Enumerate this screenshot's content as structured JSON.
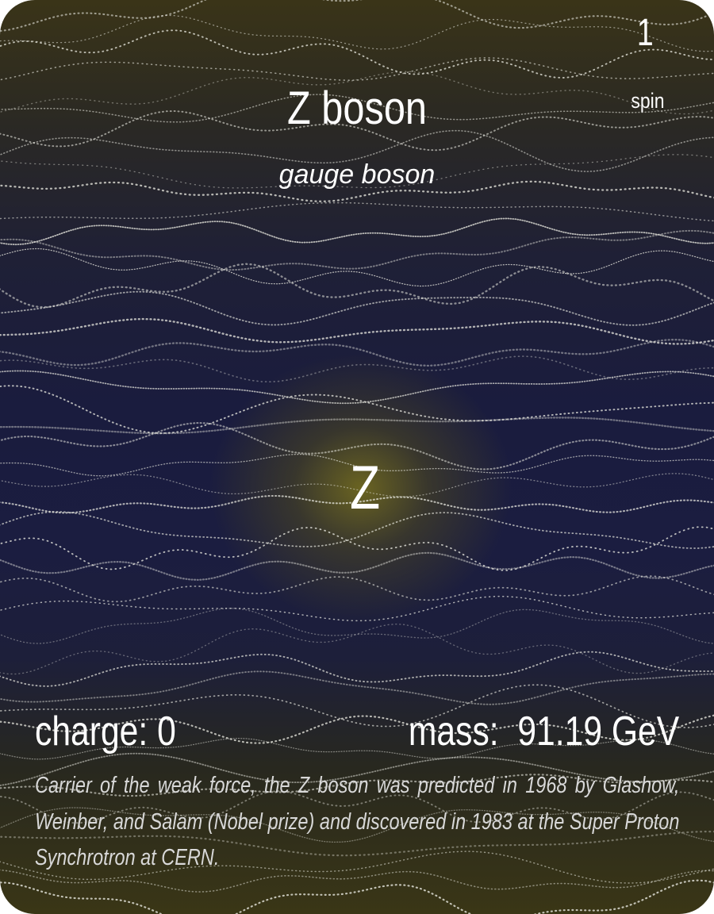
{
  "card": {
    "spin_value": "1",
    "spin_label": "spin",
    "name": "Z boson",
    "category": "gauge boson",
    "symbol": "Z",
    "charge_text": "charge: 0",
    "mass_text": "mass:  91.19 GeV",
    "description": "Carrier of the weak force, the Z boson was predicted in 1968 by Glashow, Weinber, and Salam (Nobel prize) and discovered in 1983 at the Super Proton Synchrotron at CERN."
  },
  "colors": {
    "background_top": "#3a3418",
    "background_mid": "#1a1c3e",
    "glow": "#786f1c",
    "text": "#ffffff",
    "description_text": "#d8d8d8",
    "texture_dots": "#e8e8e0"
  }
}
